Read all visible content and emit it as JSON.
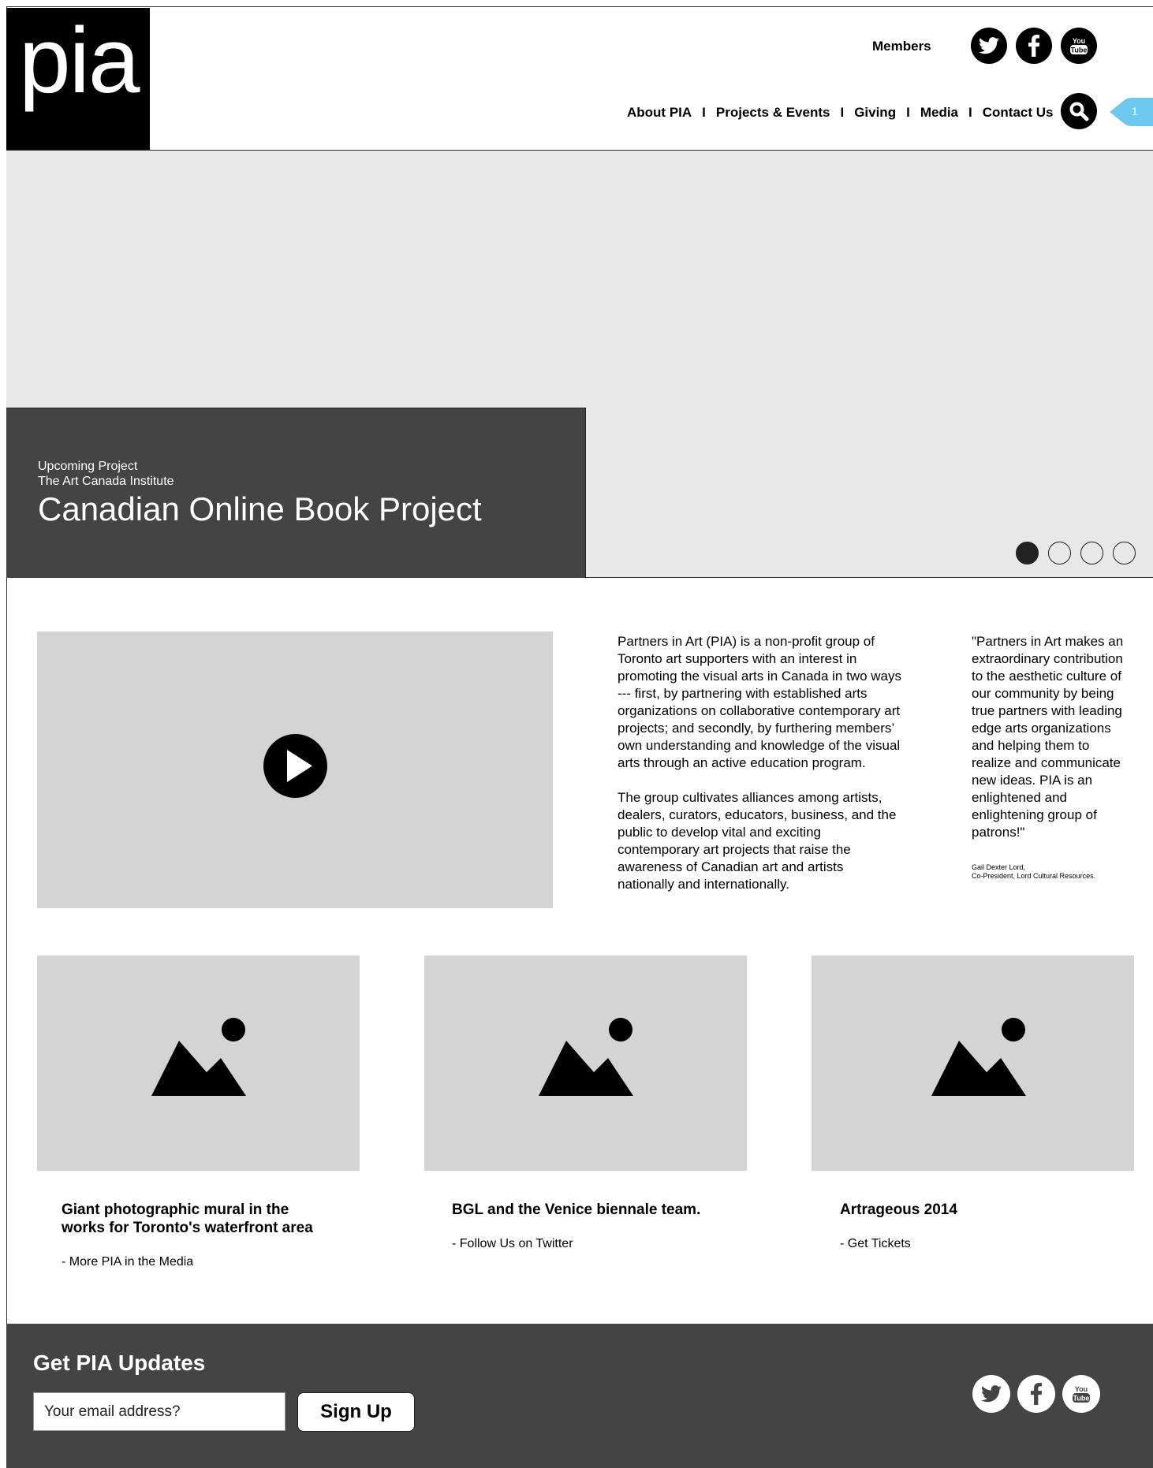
{
  "brand": {
    "logo_text": "pia"
  },
  "header": {
    "members_label": "Members",
    "nav": [
      {
        "label": "About PIA"
      },
      {
        "label": "Projects & Events"
      },
      {
        "label": "Giving"
      },
      {
        "label": "Media"
      },
      {
        "label": "Contact Us"
      }
    ],
    "nav_separator": "I",
    "badge_count": "1",
    "badge_color": "#6cc8ef",
    "social_icons": [
      "twitter-icon",
      "facebook-icon",
      "youtube-icon"
    ]
  },
  "hero": {
    "kicker_line1": "Upcoming Project",
    "kicker_line2": "The Art Canada Institute",
    "title": "Canadian Online Book Project",
    "slides_total": 4,
    "active_slide": 1
  },
  "about": {
    "paragraph1": "Partners in Art (PIA) is a non-profit group of Toronto art supporters with an interest in promoting the visual arts in Canada in two ways --- first, by partnering with established arts organizations on collaborative contemporary art projects; and secondly, by furthering members’ own understanding and knowledge of the visual arts through an active education program.",
    "paragraph2": "The group cultivates alliances among artists, dealers, curators, educators, business, and the public to develop vital and exciting contemporary art projects that raise the awareness of Canadian art and artists nationally and internationally."
  },
  "quote": {
    "text": "\"Partners in Art makes an extraordinary contribution to the aesthetic culture of our community by being true partners with leading edge arts organizations and helping them to realize and communicate new ideas. PIA is an enlightened and enlightening group of patrons!\"",
    "attribution_line1": "Gail Dexter Lord,",
    "attribution_line2": "Co-President, Lord Cultural Resources."
  },
  "cards": [
    {
      "title": "Giant photographic mural in the works for Toronto's waterfront area",
      "link": "- More PIA in the Media"
    },
    {
      "title": "BGL and the Venice biennale team.",
      "link": "- Follow Us on Twitter"
    },
    {
      "title": "Artrageous 2014",
      "link": "- Get Tickets"
    }
  ],
  "footer": {
    "title": "Get PIA Updates",
    "email_placeholder": "Your email address?",
    "signup_label": "Sign Up"
  }
}
